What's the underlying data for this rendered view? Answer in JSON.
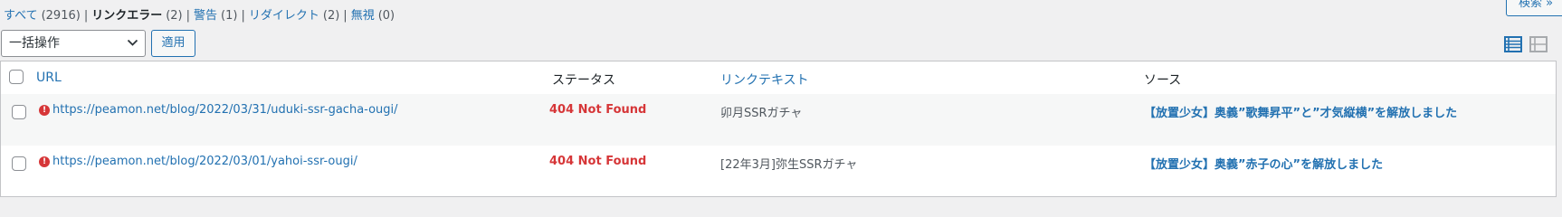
{
  "filters": [
    {
      "label": "すべて",
      "count": "(2916)",
      "current": false
    },
    {
      "label": "リンクエラー",
      "count": "(2)",
      "current": true
    },
    {
      "label": "警告",
      "count": "(1)",
      "current": false
    },
    {
      "label": "リダイレクト",
      "count": "(2)",
      "current": false
    },
    {
      "label": "無視",
      "count": "(0)",
      "current": false
    }
  ],
  "separator": "|",
  "search_button": "検索 »",
  "bulk_actions": {
    "selected": "一括操作",
    "apply": "適用"
  },
  "table": {
    "columns": {
      "url": "URL",
      "status": "ステータス",
      "link_text": "リンクテキスト",
      "source": "ソース"
    },
    "rows": [
      {
        "url": "https://peamon.net/blog/2022/03/31/uduki-ssr-gacha-ougi/",
        "status": "404 Not Found",
        "link_text": "卯月SSRガチャ",
        "source": "【放置少女】奥義”歌舞昇平”と”才気縦横”を解放しました"
      },
      {
        "url": "https://peamon.net/blog/2022/03/01/yahoi-ssr-ougi/",
        "status": "404 Not Found",
        "link_text": "[22年3月]弥生SSRガチャ",
        "source": "【放置少女】奥義”赤子の心”を解放しました"
      }
    ]
  },
  "colors": {
    "link": "#2271b1",
    "error": "#d63638",
    "background": "#f0f0f1"
  }
}
